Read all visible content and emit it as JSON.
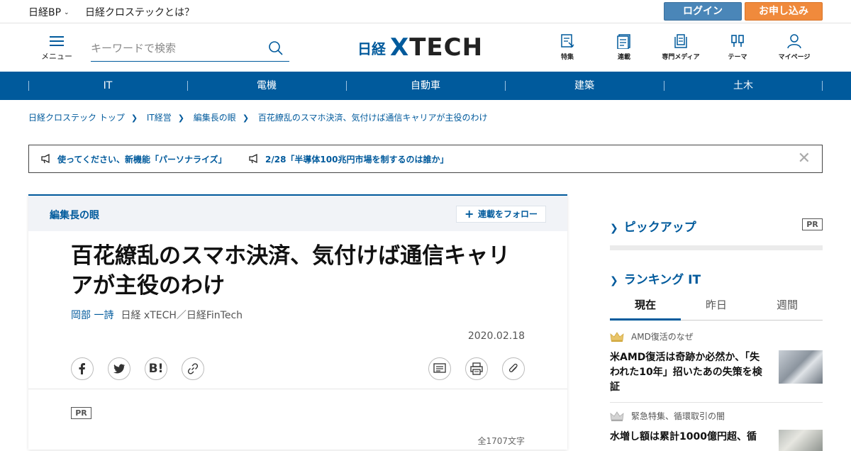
{
  "topbar": {
    "brand": "日経BP",
    "about": "日経クロステックとは？",
    "login": "ログイン",
    "apply": "お申し込み"
  },
  "header": {
    "menu_label": "メニュー",
    "search_placeholder": "キーワードで検索",
    "logo_jp": "日経",
    "logo_xtech_x": "X",
    "logo_xtech_rest": "TECH",
    "nav": [
      {
        "label": "特集",
        "icon": "feature-icon"
      },
      {
        "label": "連載",
        "icon": "series-icon"
      },
      {
        "label": "専門メディア",
        "icon": "media-icon"
      },
      {
        "label": "テーマ",
        "icon": "theme-icon"
      },
      {
        "label": "マイページ",
        "icon": "user-icon"
      }
    ]
  },
  "categories": [
    "IT",
    "電機",
    "自動車",
    "建築",
    "土木"
  ],
  "breadcrumb": [
    "日経クロステック トップ",
    "IT経営",
    "編集長の眼",
    "百花繚乱のスマホ決済、気付けば通信キャリアが主役のわけ"
  ],
  "notices": [
    "使ってください、新機能「パーソナライズ」",
    "2/28「半導体100兆円市場を制するのは誰か」"
  ],
  "article": {
    "series": "編集長の眼",
    "follow": "連載をフォロー",
    "title": "百花繚乱のスマホ決済、気付けば通信キャリアが主役のわけ",
    "author": "岡部 一詩",
    "publication": "日経 xTECH／日経FinTech",
    "date": "2020.02.18",
    "pr": "PR",
    "char_count": "全1707文字"
  },
  "sidebar": {
    "pickup_title": "ピックアップ",
    "pickup_pr": "PR",
    "ranking_title": "ランキング IT",
    "tabs": [
      "現在",
      "昨日",
      "週間"
    ],
    "active_tab": 0,
    "rankings": [
      {
        "caption": "AMD復活のなぜ",
        "headline": "米AMD復活は奇跡か必然か、「失われた10年」招いたあの失策を検証"
      },
      {
        "caption": "緊急特集、循環取引の闇",
        "headline": "水増し額は累計1000億円超、循"
      }
    ]
  },
  "colors": {
    "brand_blue": "#005a9c",
    "login_blue": "#4a86b8",
    "apply_orange": "#f08a3c"
  }
}
